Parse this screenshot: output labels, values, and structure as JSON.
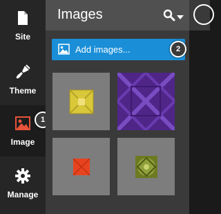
{
  "sidebar": {
    "items": [
      {
        "label": "Site",
        "icon": "document-icon"
      },
      {
        "label": "Theme",
        "icon": "brush-icon"
      },
      {
        "label": "Image",
        "icon": "image-icon",
        "active": true
      },
      {
        "label": "Manage",
        "icon": "gear-icon"
      }
    ]
  },
  "callouts": {
    "one": "1",
    "two": "2"
  },
  "panel": {
    "title": "Images",
    "add_button_label": "Add images..."
  },
  "colors": {
    "accent": "#1a8fd8",
    "active_icon": "#e8533a",
    "sidebar_bg": "#262626",
    "panel_bg": "#3a3a3a",
    "header_bg": "#505050"
  },
  "thumbnails": [
    {
      "name": "yellow-quilt-pattern",
      "color": "#d8c83a"
    },
    {
      "name": "purple-diamond-pattern",
      "color": "#5a2d94"
    },
    {
      "name": "red-square-pattern",
      "color": "#e8431f"
    },
    {
      "name": "green-medallion-pattern",
      "color": "#7a8a2a"
    }
  ]
}
